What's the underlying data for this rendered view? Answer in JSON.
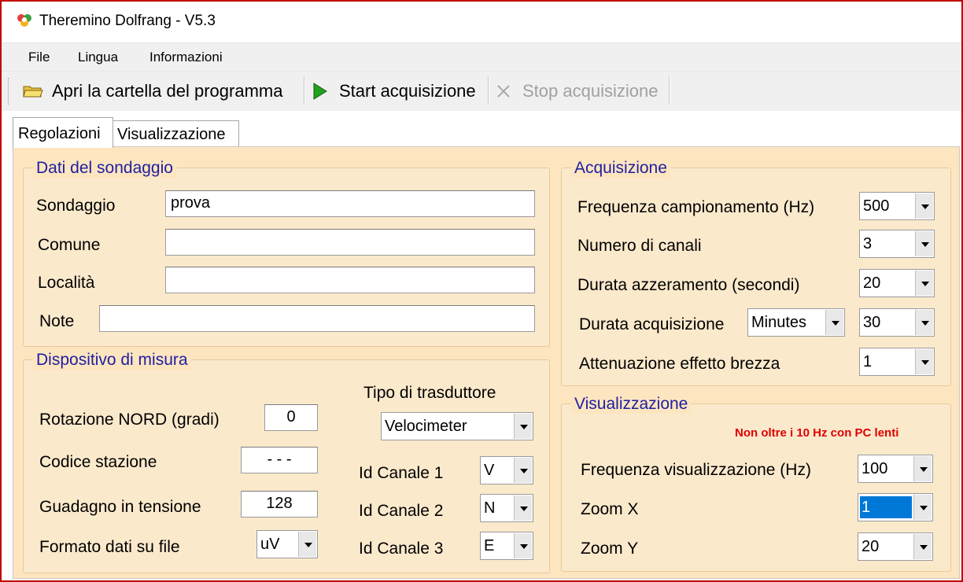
{
  "window": {
    "title": "Theremino Dolfrang - V5.3"
  },
  "menu": {
    "file": "File",
    "lingua": "Lingua",
    "informazioni": "Informazioni"
  },
  "toolbar": {
    "open_folder": "Apri la cartella del programma",
    "start": "Start acquisizione",
    "stop": "Stop acquisizione"
  },
  "tabs": {
    "regolazioni": "Regolazioni",
    "visualizzazione": "Visualizzazione"
  },
  "dati": {
    "title": "Dati del sondaggio",
    "sondaggio_label": "Sondaggio",
    "sondaggio_value": "prova",
    "comune_label": "Comune",
    "comune_value": "",
    "localita_label": "Località",
    "localita_value": "",
    "note_label": "Note",
    "note_value": ""
  },
  "dispositivo": {
    "title": "Dispositivo di misura",
    "rotazione_label": "Rotazione NORD (gradi)",
    "rotazione_value": "0",
    "codice_label": "Codice stazione",
    "codice_value": "- - -",
    "guadagno_label": "Guadagno in tensione",
    "guadagno_value": "128",
    "formato_label": "Formato dati su file",
    "formato_value": "uV",
    "tipo_label": "Tipo di trasduttore",
    "tipo_value": "Velocimeter",
    "canale1_label": "Id Canale 1",
    "canale1_value": "V",
    "canale2_label": "Id Canale 2",
    "canale2_value": "N",
    "canale3_label": "Id Canale 3",
    "canale3_value": "E"
  },
  "acquisizione": {
    "title": "Acquisizione",
    "frequenza_label": "Frequenza campionamento (Hz)",
    "frequenza_value": "500",
    "canali_label": "Numero di canali",
    "canali_value": "3",
    "azzeramento_label": "Durata azzeramento (secondi)",
    "azzeramento_value": "20",
    "durata_label": "Durata acquisizione",
    "durata_unit": "Minutes",
    "durata_value": "30",
    "brezza_label": "Attenuazione effetto brezza",
    "brezza_value": "1"
  },
  "visualizzazione": {
    "title": "Visualizzazione",
    "warning": "Non oltre i 10 Hz con PC lenti",
    "frequenza_label": "Frequenza visualizzazione (Hz)",
    "frequenza_value": "100",
    "zoomx_label": "Zoom X",
    "zoomx_value": "1",
    "zoomy_label": "Zoom Y",
    "zoomy_value": "20"
  }
}
